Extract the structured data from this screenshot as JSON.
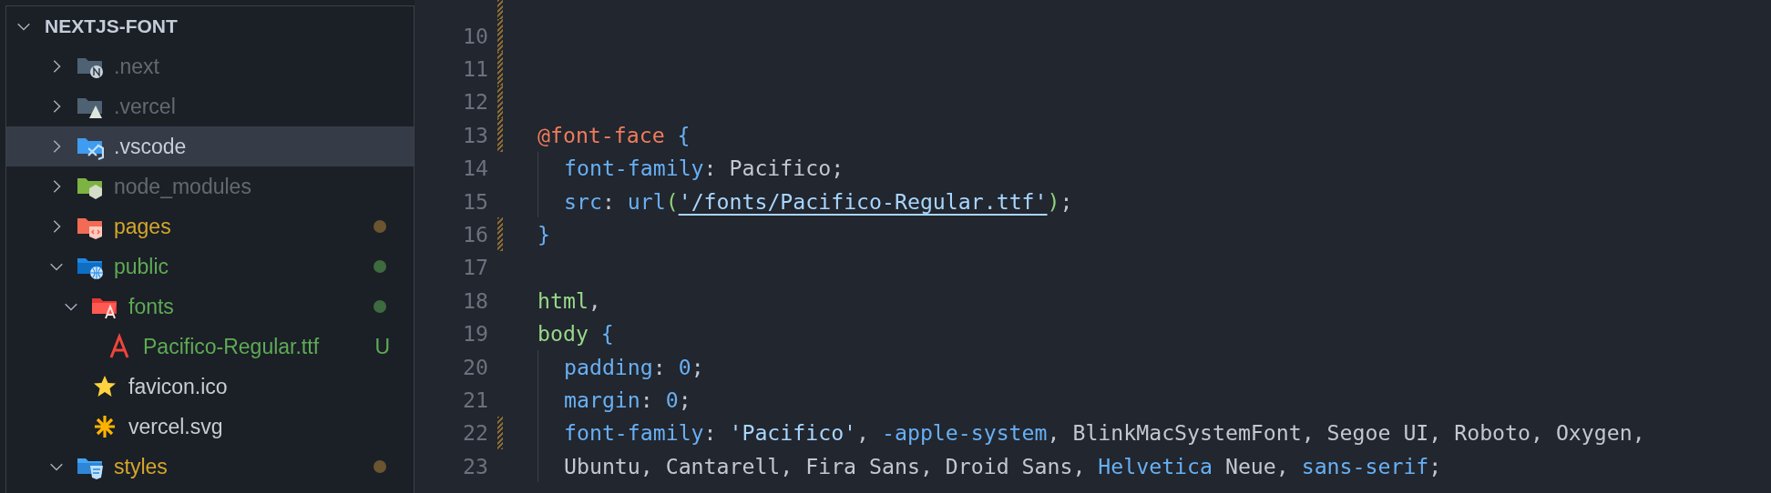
{
  "explorer": {
    "root": {
      "label": "NEXTJS-FONT",
      "expanded": true
    },
    "items": [
      {
        "name": ".next",
        "kind": "next",
        "expanded": false,
        "ignored": true,
        "modified": false,
        "untracked": false,
        "selected": false,
        "dot": false
      },
      {
        "name": ".vercel",
        "kind": "vercel",
        "expanded": false,
        "ignored": true,
        "modified": false,
        "untracked": false,
        "selected": false,
        "dot": false
      },
      {
        "name": ".vscode",
        "kind": "vscode",
        "expanded": false,
        "ignored": false,
        "modified": false,
        "untracked": false,
        "selected": true,
        "dot": false
      },
      {
        "name": "node_modules",
        "kind": "node",
        "expanded": false,
        "ignored": true,
        "modified": false,
        "untracked": false,
        "selected": false,
        "dot": false
      },
      {
        "name": "pages",
        "kind": "pages",
        "expanded": false,
        "ignored": false,
        "modified": true,
        "untracked": false,
        "selected": false,
        "dot": true
      },
      {
        "name": "public",
        "kind": "public",
        "expanded": true,
        "ignored": false,
        "modified": false,
        "untracked": true,
        "selected": false,
        "dot": true,
        "children": [
          {
            "name": "fonts",
            "kind": "fonts",
            "expanded": true,
            "ignored": false,
            "modified": false,
            "untracked": true,
            "selected": false,
            "dot": true,
            "children": [
              {
                "name": "Pacifico-Regular.ttf",
                "kind": "font",
                "ignored": false,
                "modified": false,
                "untracked": true,
                "selected": false,
                "dot": false,
                "badge": "U"
              }
            ]
          },
          {
            "name": "favicon.ico",
            "kind": "star",
            "ignored": false,
            "modified": false,
            "untracked": false,
            "selected": false,
            "dot": false
          },
          {
            "name": "vercel.svg",
            "kind": "asterisk",
            "ignored": false,
            "modified": false,
            "untracked": false,
            "selected": false,
            "dot": false
          }
        ]
      },
      {
        "name": "styles",
        "kind": "styles",
        "expanded": true,
        "ignored": false,
        "modified": true,
        "untracked": false,
        "selected": false,
        "dot": true
      }
    ]
  },
  "editor": {
    "lines": [
      {
        "number": "10",
        "changed": true
      },
      {
        "number": "11",
        "changed": true
      },
      {
        "number": "12",
        "changed": true
      },
      {
        "number": "13",
        "changed": true,
        "indented": false,
        "tokens": [
          {
            "kind": "at-rule",
            "text": "@font-face"
          },
          {
            "kind": "punct-blue",
            "text": " {"
          }
        ]
      },
      {
        "number": "14",
        "changed": false,
        "indented": true,
        "tokens": [
          {
            "kind": "property",
            "text": "font-family"
          },
          {
            "kind": "plain",
            "text": ": Pacifico;"
          }
        ]
      },
      {
        "number": "15",
        "changed": false,
        "indented": true,
        "tokens": [
          {
            "kind": "property",
            "text": "src"
          },
          {
            "kind": "plain",
            "text": ": "
          },
          {
            "kind": "function",
            "text": "url"
          },
          {
            "kind": "paren",
            "text": "("
          },
          {
            "kind": "link",
            "text": "'/fonts/Pacifico-Regular.ttf'"
          },
          {
            "kind": "paren",
            "text": ")"
          },
          {
            "kind": "plain",
            "text": ";"
          }
        ]
      },
      {
        "number": "16",
        "changed": true,
        "indented": false,
        "tokens": [
          {
            "kind": "punct-blue",
            "text": "}"
          }
        ]
      },
      {
        "number": "17",
        "changed": false
      },
      {
        "number": "18",
        "changed": false,
        "indented": false,
        "tokens": [
          {
            "kind": "selector",
            "text": "html"
          },
          {
            "kind": "plain",
            "text": ","
          }
        ]
      },
      {
        "number": "19",
        "changed": false,
        "indented": false,
        "tokens": [
          {
            "kind": "selector",
            "text": "body"
          },
          {
            "kind": "punct-blue",
            "text": " {"
          }
        ]
      },
      {
        "number": "20",
        "changed": false,
        "indented": true,
        "tokens": [
          {
            "kind": "property",
            "text": "padding"
          },
          {
            "kind": "plain",
            "text": ": "
          },
          {
            "kind": "number",
            "text": "0"
          },
          {
            "kind": "plain",
            "text": ";"
          }
        ]
      },
      {
        "number": "21",
        "changed": false,
        "indented": true,
        "tokens": [
          {
            "kind": "property",
            "text": "margin"
          },
          {
            "kind": "plain",
            "text": ": "
          },
          {
            "kind": "number",
            "text": "0"
          },
          {
            "kind": "plain",
            "text": ";"
          }
        ]
      },
      {
        "number": "22",
        "changed": true,
        "indented": true,
        "tokens": [
          {
            "kind": "property",
            "text": "font-family"
          },
          {
            "kind": "plain",
            "text": ": "
          },
          {
            "kind": "string",
            "text": "'Pacifico'"
          },
          {
            "kind": "plain",
            "text": ", "
          },
          {
            "kind": "keyword",
            "text": "-apple-system"
          },
          {
            "kind": "plain",
            "text": ", BlinkMacSystemFont, Segoe UI, Roboto, Oxygen,"
          }
        ]
      },
      {
        "number": "23",
        "changed": false,
        "indented": true,
        "tokens": [
          {
            "kind": "plain",
            "text": "Ubuntu, Cantarell, Fira Sans, Droid Sans, "
          },
          {
            "kind": "keyword",
            "text": "Helvetica"
          },
          {
            "kind": "plain",
            "text": " Neue, "
          },
          {
            "kind": "keyword",
            "text": "sans-serif"
          },
          {
            "kind": "plain",
            "text": ";"
          }
        ]
      }
    ]
  }
}
